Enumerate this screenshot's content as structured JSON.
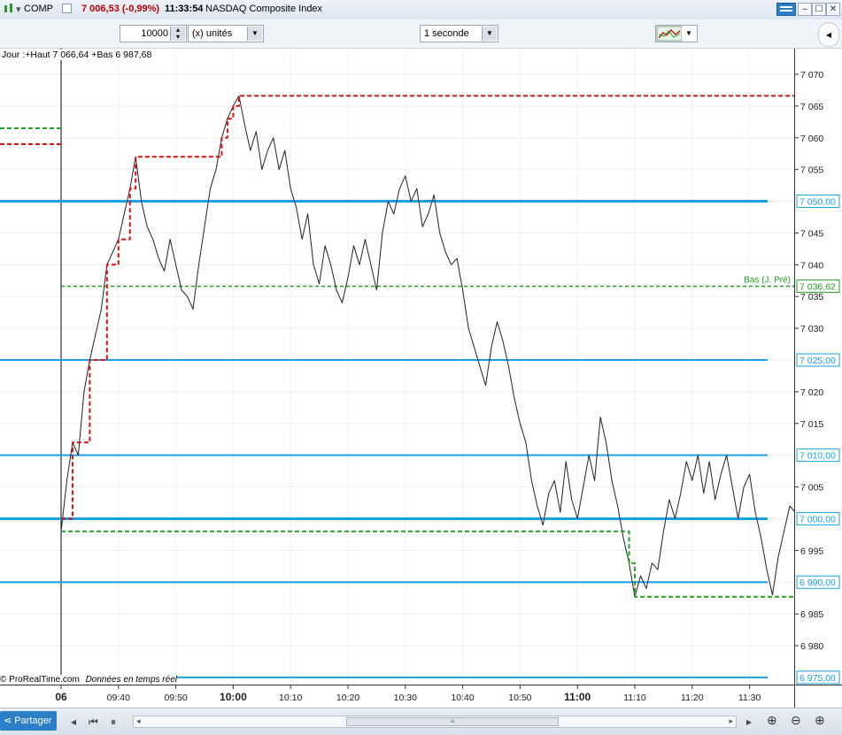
{
  "titlebar": {
    "ticker": "COMP",
    "price_change": "7 006,53 (-0,99%)",
    "time": "11:33:54",
    "instrument": "NASDAQ Composite Index"
  },
  "toolbar": {
    "quantity": "10000",
    "units": "(x) unités",
    "interval": "1 seconde"
  },
  "chart_info": "Jour :+Haut 7 066,64 +Bas 6 987,68",
  "footer_credit": "© ProRealTime.com",
  "footer_realtime": "Données en temps réel",
  "bottom": {
    "share_label": "Partager"
  },
  "colors": {
    "price_line": "#222222",
    "high_line": "#dd1111",
    "low_line": "#22a022",
    "level_line": "#1aa0e6",
    "axis_highlight": "#1aa0e6",
    "label_green": "#22a022"
  },
  "chart_data": {
    "type": "line",
    "y_range": [
      6973,
      7075
    ],
    "y_ticks": [
      "7 070",
      "7 065",
      "7 060",
      "7 055",
      "7 045",
      "7 040",
      "7 035",
      "7 030",
      "7 020",
      "7 015",
      "7 005",
      "6 995",
      "6 985",
      "6 980"
    ],
    "x_ticks": [
      {
        "t": "06",
        "bold": true
      },
      {
        "t": "09:40",
        "bold": false
      },
      {
        "t": "09:50",
        "bold": false
      },
      {
        "t": "10:00",
        "bold": true
      },
      {
        "t": "10:10",
        "bold": false
      },
      {
        "t": "10:20",
        "bold": false
      },
      {
        "t": "10:30",
        "bold": false
      },
      {
        "t": "10:40",
        "bold": false
      },
      {
        "t": "10:50",
        "bold": false
      },
      {
        "t": "11:00",
        "bold": true
      },
      {
        "t": "11:10",
        "bold": false
      },
      {
        "t": "11:20",
        "bold": false
      },
      {
        "t": "11:30",
        "bold": false
      }
    ],
    "x_tick_minutes": [
      -10,
      10,
      20,
      30,
      40,
      50,
      60,
      70,
      80,
      90,
      100,
      110,
      120
    ],
    "session_start_minute": 0,
    "horizontal_levels": [
      {
        "value": 7050,
        "label": "7 050,00",
        "thick": true
      },
      {
        "value": 7025,
        "label": "7 025,00",
        "thick": false
      },
      {
        "value": 7010,
        "label": "7 010,00",
        "thick": false
      },
      {
        "value": 7000,
        "label": "7 000,00",
        "thick": true
      },
      {
        "value": 6990,
        "label": "6 990,00",
        "thick": false
      },
      {
        "value": 6975,
        "label": "6 975,00",
        "thick": false
      }
    ],
    "prev_day_low": {
      "value": 7036.62,
      "label": "7 036,62",
      "caption": "Bas (J. Pré)"
    },
    "left_segments": [
      {
        "value": 7061.5,
        "color": "green"
      },
      {
        "value": 7059,
        "color": "red"
      }
    ],
    "series": [
      {
        "name": "price",
        "points": [
          [
            0,
            6998
          ],
          [
            1,
            7006
          ],
          [
            2,
            7012
          ],
          [
            3,
            7010
          ],
          [
            4,
            7020
          ],
          [
            5,
            7025
          ],
          [
            6,
            7029
          ],
          [
            7,
            7033
          ],
          [
            8,
            7040
          ],
          [
            9,
            7042
          ],
          [
            10,
            7044
          ],
          [
            11,
            7048
          ],
          [
            12,
            7052
          ],
          [
            13,
            7057
          ],
          [
            14,
            7050
          ],
          [
            15,
            7046
          ],
          [
            16,
            7044
          ],
          [
            17,
            7041
          ],
          [
            18,
            7039
          ],
          [
            19,
            7044
          ],
          [
            20,
            7040
          ],
          [
            21,
            7036
          ],
          [
            22,
            7035
          ],
          [
            23,
            7033
          ],
          [
            24,
            7040
          ],
          [
            25,
            7046
          ],
          [
            26,
            7052
          ],
          [
            27,
            7055
          ],
          [
            28,
            7060
          ],
          [
            29,
            7063
          ],
          [
            30,
            7065
          ],
          [
            31,
            7066.6
          ],
          [
            32,
            7062
          ],
          [
            33,
            7058
          ],
          [
            34,
            7061
          ],
          [
            35,
            7055
          ],
          [
            36,
            7058
          ],
          [
            37,
            7060
          ],
          [
            38,
            7055
          ],
          [
            39,
            7058
          ],
          [
            40,
            7052
          ],
          [
            41,
            7049
          ],
          [
            42,
            7044
          ],
          [
            43,
            7048
          ],
          [
            44,
            7040
          ],
          [
            45,
            7037
          ],
          [
            46,
            7043
          ],
          [
            47,
            7040
          ],
          [
            48,
            7036
          ],
          [
            49,
            7034
          ],
          [
            50,
            7038
          ],
          [
            51,
            7043
          ],
          [
            52,
            7040
          ],
          [
            53,
            7044
          ],
          [
            54,
            7040
          ],
          [
            55,
            7036
          ],
          [
            56,
            7045
          ],
          [
            57,
            7050
          ],
          [
            58,
            7048
          ],
          [
            59,
            7052
          ],
          [
            60,
            7054
          ],
          [
            61,
            7050
          ],
          [
            62,
            7052
          ],
          [
            63,
            7046
          ],
          [
            64,
            7048
          ],
          [
            65,
            7051
          ],
          [
            66,
            7045
          ],
          [
            67,
            7042
          ],
          [
            68,
            7040
          ],
          [
            69,
            7041
          ],
          [
            70,
            7036
          ],
          [
            71,
            7030
          ],
          [
            72,
            7027
          ],
          [
            73,
            7024
          ],
          [
            74,
            7021
          ],
          [
            75,
            7027
          ],
          [
            76,
            7031
          ],
          [
            77,
            7028
          ],
          [
            78,
            7024
          ],
          [
            79,
            7019
          ],
          [
            80,
            7015
          ],
          [
            81,
            7012
          ],
          [
            82,
            7006
          ],
          [
            83,
            7002
          ],
          [
            84,
            6999
          ],
          [
            85,
            7004
          ],
          [
            86,
            7006
          ],
          [
            87,
            7001
          ],
          [
            88,
            7009
          ],
          [
            89,
            7003
          ],
          [
            90,
            7000
          ],
          [
            91,
            7005
          ],
          [
            92,
            7010
          ],
          [
            93,
            7006
          ],
          [
            94,
            7016
          ],
          [
            95,
            7012
          ],
          [
            96,
            7006
          ],
          [
            97,
            7002
          ],
          [
            98,
            6997
          ],
          [
            99,
            6993
          ],
          [
            100,
            6987.7
          ],
          [
            101,
            6991
          ],
          [
            102,
            6989
          ],
          [
            103,
            6993
          ],
          [
            104,
            6992
          ],
          [
            105,
            6998
          ],
          [
            106,
            7003
          ],
          [
            107,
            7000
          ],
          [
            108,
            7004
          ],
          [
            109,
            7009
          ],
          [
            110,
            7006
          ],
          [
            111,
            7010
          ],
          [
            112,
            7004
          ],
          [
            113,
            7009
          ],
          [
            114,
            7003
          ],
          [
            115,
            7007
          ],
          [
            116,
            7010
          ],
          [
            117,
            7005
          ],
          [
            118,
            7000
          ],
          [
            119,
            7005
          ],
          [
            120,
            7007
          ],
          [
            121,
            7001
          ],
          [
            122,
            6997
          ],
          [
            123,
            6992
          ],
          [
            124,
            6988
          ],
          [
            125,
            6994
          ],
          [
            126,
            6998
          ],
          [
            127,
            7002
          ],
          [
            128,
            7001
          ],
          [
            129,
            6999
          ],
          [
            130,
            7003
          ],
          [
            131,
            7001
          ],
          [
            132,
            7004
          ],
          [
            133,
            7006.5
          ]
        ]
      },
      {
        "name": "running_high",
        "points": [
          [
            0,
            7000
          ],
          [
            2,
            7012
          ],
          [
            5,
            7025
          ],
          [
            8,
            7040
          ],
          [
            10,
            7044
          ],
          [
            12,
            7052
          ],
          [
            13,
            7057
          ],
          [
            27,
            7057
          ],
          [
            28,
            7060
          ],
          [
            29,
            7063
          ],
          [
            30,
            7065
          ],
          [
            31,
            7066.6
          ],
          [
            133,
            7066.6
          ]
        ]
      },
      {
        "name": "running_low",
        "points": [
          [
            0,
            6998
          ],
          [
            98,
            6998
          ],
          [
            99,
            6993
          ],
          [
            100,
            6987.7
          ],
          [
            133,
            6987.7
          ]
        ]
      }
    ]
  }
}
